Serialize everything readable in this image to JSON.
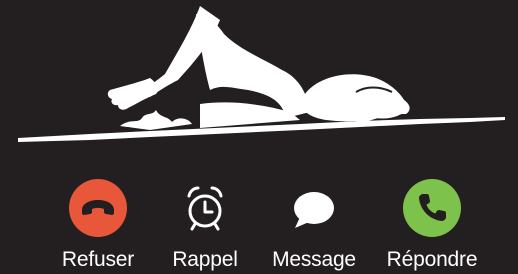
{
  "caller_image": {
    "icon": "swimmer-illustration",
    "color": "#ffffff"
  },
  "background_color": "#231f20",
  "actions": [
    {
      "id": "decline",
      "label": "Refuser",
      "icon": "phone-hangup-icon",
      "color": "#e8573a"
    },
    {
      "id": "remind",
      "label": "Rappel",
      "icon": "alarm-clock-icon",
      "color": "#ffffff"
    },
    {
      "id": "message",
      "label": "Message",
      "icon": "speech-bubble-icon",
      "color": "#ffffff"
    },
    {
      "id": "accept",
      "label": "Répondre",
      "icon": "phone-icon",
      "color": "#7dc24a"
    }
  ]
}
